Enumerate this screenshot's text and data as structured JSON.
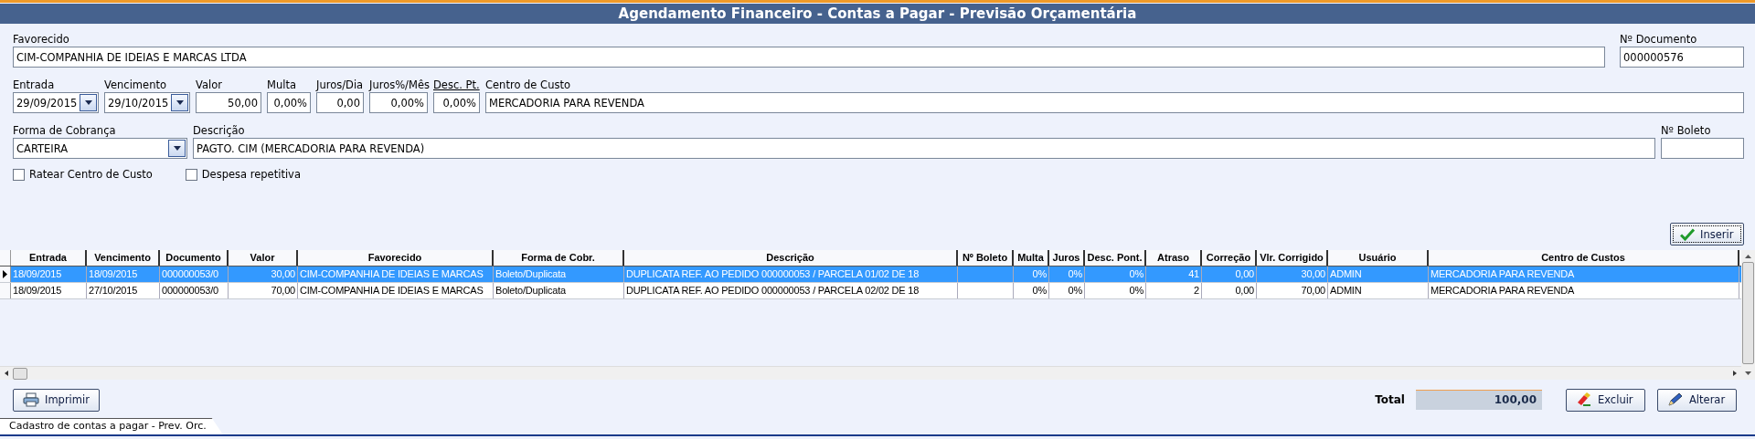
{
  "window": {
    "title": "Agendamento Financeiro - Contas a Pagar - Previsão Orçamentária"
  },
  "form": {
    "favorecido": {
      "label": "Favorecido",
      "value": "CIM-COMPANHIA DE IDEIAS E MARCAS LTDA"
    },
    "numero_documento": {
      "label": "Nº Documento",
      "value": "000000576"
    },
    "entrada": {
      "label": "Entrada",
      "value": "29/09/2015"
    },
    "vencimento": {
      "label": "Vencimento",
      "value": "29/10/2015"
    },
    "valor": {
      "label": "Valor",
      "value": "50,00"
    },
    "multa": {
      "label": "Multa",
      "value": "0,00%"
    },
    "juros_dia": {
      "label": "Juros/Dia",
      "value": "0,00"
    },
    "juros_mes": {
      "label": "Juros%/Mês",
      "value": "0,00%"
    },
    "desc_pt": {
      "label": "Desc. Pt.",
      "value": "0,00%",
      "underlined": true
    },
    "centro_de_custo": {
      "label": "Centro de Custo",
      "value": "MERCADORIA PARA REVENDA"
    },
    "forma_de_cobranca": {
      "label": "Forma de Cobrança",
      "value": "CARTEIRA"
    },
    "descricao": {
      "label": "Descrição",
      "value": "PAGTO. CIM (MERCADORIA PARA REVENDA)"
    },
    "numero_boleto": {
      "label": "Nº Boleto"
    },
    "checkboxes": [
      {
        "label": "Ratear Centro de Custo",
        "checked": false
      },
      {
        "label": "Despesa repetitiva",
        "checked": false
      }
    ]
  },
  "insert_button": "Inserir",
  "table": {
    "columns": [
      "Entrada",
      "Vencimento",
      "Documento",
      "Valor",
      "Favorecido",
      "Forma de Cobr.",
      "Descrição",
      "Nº Boleto",
      "Multa",
      "Juros",
      "Desc. Pont.",
      "Atraso",
      "Correção",
      "Vlr. Corrigido",
      "Usuário",
      "Centro de Custos"
    ],
    "rows": [
      {
        "selected": true,
        "cells": [
          "18/09/2015",
          "18/09/2015",
          "000000053/0",
          "30,00",
          "CIM-COMPANHIA DE IDEIAS E MARCAS",
          "Boleto/Duplicata",
          "DUPLICATA REF. AO PEDIDO 000000053 / PARCELA 01/02 DE 18",
          null,
          "0%",
          "0%",
          "0%",
          "41",
          "0,00",
          "30,00",
          "ADMIN",
          "MERCADORIA PARA REVENDA"
        ]
      },
      {
        "selected": false,
        "cells": [
          "18/09/2015",
          "27/10/2015",
          "000000053/0",
          "70,00",
          "CIM-COMPANHIA DE IDEIAS E MARCAS",
          "Boleto/Duplicata",
          "DUPLICATA REF. AO PEDIDO 000000053 / PARCELA 02/02 DE 18",
          null,
          "0%",
          "0%",
          "0%",
          "2",
          "0,00",
          "70,00",
          "ADMIN",
          "MERCADORIA PARA REVENDA"
        ]
      }
    ]
  },
  "footer": {
    "print_button": "Imprimir",
    "total_label": "Total",
    "total_value": "100,00",
    "buttons": [
      {
        "kind": "delete",
        "label": "Excluir"
      },
      {
        "kind": "edit",
        "label": "Alterar"
      }
    ]
  },
  "status_tab": "Cadastro de contas a pagar - Prev. Orc."
}
